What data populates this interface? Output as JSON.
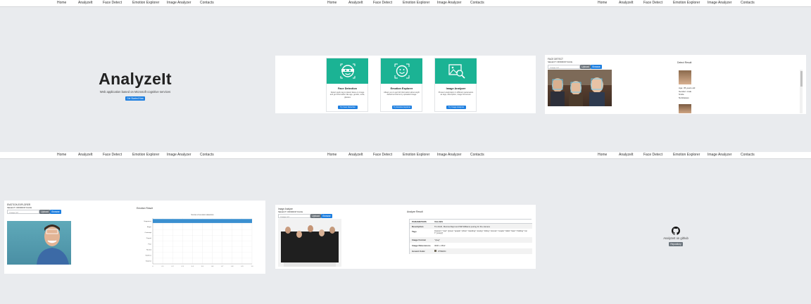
{
  "nav": {
    "items": [
      "Home",
      "AnalyzeIt",
      "Face Detect",
      "Emotion Explorer",
      "Image Analyzer",
      "Contacts"
    ]
  },
  "home": {
    "title": "AnalyzeIt",
    "subtitle": "Web application based on Microsoft cognitive services",
    "cta": "Get Started Now"
  },
  "features": [
    {
      "title": "Face Detection",
      "desc": "Detect quick tag to detect faces on image and get information like age, gender, smile, glasses",
      "button": "Try Face Detection",
      "icon": "face-scan-icon"
    },
    {
      "title": "Emotion Explorer",
      "desc": "Allows you to get full information about eight default emotions by uploaded image",
      "button": "Try Emotion Explorer",
      "icon": "smiley-icon"
    },
    {
      "title": "Image Analyzer",
      "desc": "Present analyzation in different parameters as tags, description, image format etc.",
      "button": "Try Image Analyzer",
      "icon": "image-search-icon"
    }
  ],
  "face_detect": {
    "heading": "FACE DETECT",
    "select_label": "SELECT OR/DROP FACE",
    "url_placeholder": "Image Url",
    "upload": "Upload",
    "browse": "Browse",
    "result_title": "Detect Result",
    "attrs": [
      "Age: 35 years old",
      "Gender: male",
      "Smile",
      "NoGlasses"
    ]
  },
  "emotion": {
    "heading": "EMOTION EXPLORER",
    "select_label": "SELECT OR/DROP FACE",
    "url_placeholder": "Image Url",
    "upload": "Upload",
    "browse": "Browse",
    "result_title": "Emotion Result",
    "chart_title": "Scores of emotion detection"
  },
  "chart_data": {
    "type": "bar",
    "orientation": "horizontal",
    "title": "Scores of emotion detection",
    "categories": [
      "Happiness",
      "Anger",
      "Contempt",
      "Disgust",
      "Fear",
      "Neutral",
      "Sadness",
      "Surprise"
    ],
    "values": [
      1.0,
      0,
      0,
      0,
      0,
      0,
      0,
      0
    ],
    "xlim": [
      0,
      1
    ],
    "xticks": [
      "0",
      "0.1",
      "0.2",
      "0.3",
      "0.4",
      "0.5",
      "0.6",
      "0.7",
      "0.8",
      "0.9",
      "1.0"
    ],
    "grid": true,
    "bar_color": "#3a8fd0"
  },
  "analyzer": {
    "heading": "Image Analyze",
    "select_label": "SELECT OR/DROP FACE",
    "url_placeholder": "Image Url",
    "upload": "Upload",
    "browse": "Browse",
    "result_title": "Analyze Result",
    "table_header": [
      "PARAMETERS",
      "VALUES"
    ],
    "rows": [
      [
        "Description",
        "Tim Roth, Monica Raymond Will Williams posing for the camera"
      ],
      [
        "Tags",
        "[\"person\",\"man\",\"group\",\"people\",\"photo\",\"standing\",\"posing\",\"sitting\",\"woman\",\"couple\",\"table\",\"lawn\",\"holding\",\"suit\",\"young\"]"
      ],
      [
        "Image Format",
        "\"Jpeg\""
      ],
      [
        "Image Dimensions",
        "3000 x 2522"
      ],
      [
        "Accent Color",
        "#756E5C"
      ]
    ],
    "accent": "#756E5C"
  },
  "contacts": {
    "label": "AnalyzeIt on github",
    "button": "Repository",
    "icon": "github-icon"
  },
  "colors": {
    "primary": "#1e7fe0",
    "teal": "#1bb394",
    "bg": "#e9ebee"
  }
}
